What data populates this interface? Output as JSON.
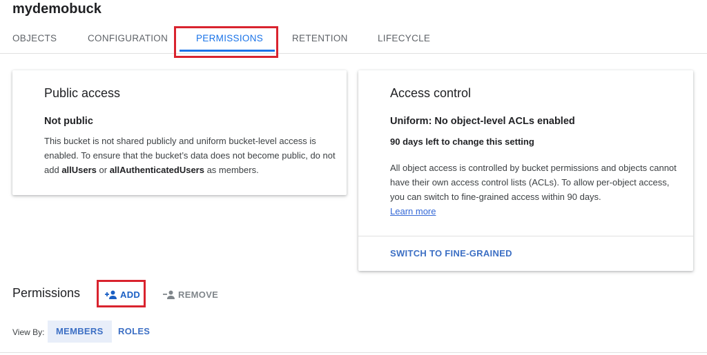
{
  "bucket": {
    "name": "mydemobuck"
  },
  "tabs": [
    {
      "label": "OBJECTS"
    },
    {
      "label": "CONFIGURATION"
    },
    {
      "label": "PERMISSIONS",
      "active": true
    },
    {
      "label": "RETENTION"
    },
    {
      "label": "LIFECYCLE"
    }
  ],
  "public_access": {
    "title": "Public access",
    "status": "Not public",
    "desc_part1": "This bucket is not shared publicly and uniform bucket-level access is enabled. To ensure that the bucket’s data does not become public, do not add ",
    "all_users": "allUsers",
    "or_text": " or ",
    "all_auth_users": "allAuthenticatedUsers",
    "desc_part2": " as members."
  },
  "access_control": {
    "title": "Access control",
    "mode": "Uniform: No object-level ACLs enabled",
    "days_left": "90 days left to change this setting",
    "description": "All object access is controlled by bucket permissions and objects cannot have their own access control lists (ACLs). To allow per-object access, you can switch to fine-grained access within 90 days.",
    "learn_more": "Learn more",
    "switch_button": "SWITCH TO FINE-GRAINED"
  },
  "permissions": {
    "title": "Permissions",
    "add_label": "ADD",
    "remove_label": "REMOVE",
    "view_by_label": "View By:",
    "view_options": [
      "MEMBERS",
      "ROLES"
    ],
    "selected_view": "MEMBERS"
  },
  "colors": {
    "accent": "#1a73e8",
    "highlight_box": "#d9232e",
    "button_text": "#3c6fc4",
    "selected_segment_bg": "#e8eef9"
  }
}
